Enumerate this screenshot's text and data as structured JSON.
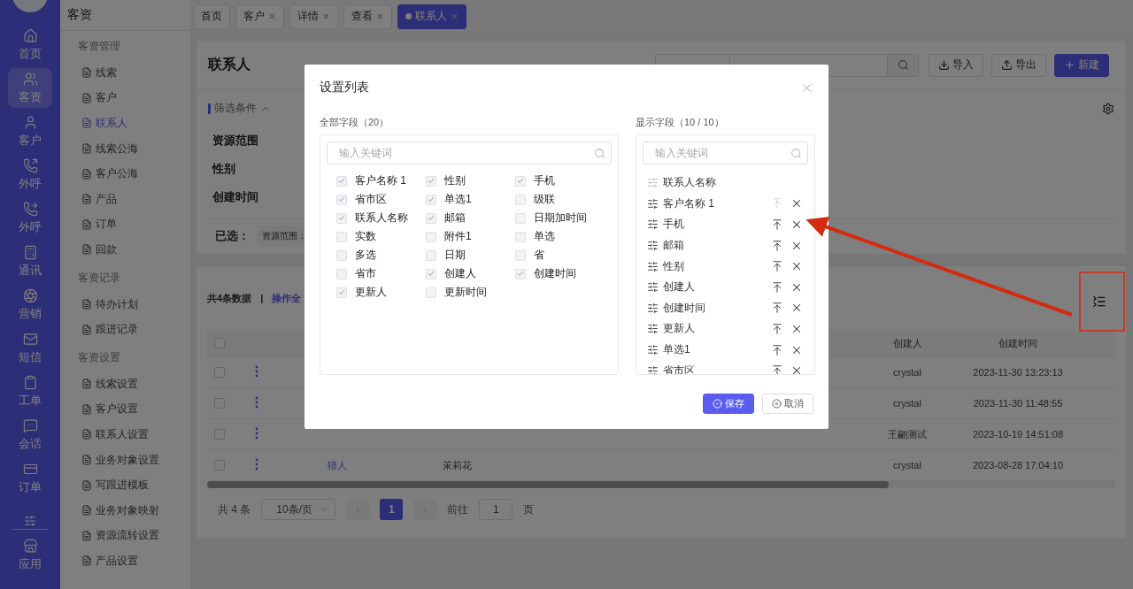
{
  "icon_nav": {
    "items": [
      {
        "label": "首页",
        "selected": false
      },
      {
        "label": "客资",
        "selected": true
      },
      {
        "label": "客户",
        "selected": false
      },
      {
        "label": "外呼",
        "selected": false
      },
      {
        "label": "外呼",
        "selected": false
      },
      {
        "label": "通讯",
        "selected": false
      },
      {
        "label": "营销",
        "selected": false
      },
      {
        "label": "短信",
        "selected": false
      },
      {
        "label": "工单",
        "selected": false
      },
      {
        "label": "会话",
        "selected": false
      },
      {
        "label": "订单",
        "selected": false
      }
    ],
    "footer_item": {
      "label": "应用",
      "selected": false
    }
  },
  "sub_nav": {
    "title": "客资",
    "groups": [
      {
        "title": "客资管理",
        "items": [
          {
            "label": "线索",
            "selected": false
          },
          {
            "label": "客户",
            "selected": false
          },
          {
            "label": "联系人",
            "selected": true
          },
          {
            "label": "线索公海",
            "selected": false
          },
          {
            "label": "客户公海",
            "selected": false
          },
          {
            "label": "产品",
            "selected": false
          },
          {
            "label": "订单",
            "selected": false
          },
          {
            "label": "回款",
            "selected": false
          }
        ]
      },
      {
        "title": "客资记录",
        "items": [
          {
            "label": "待办计划",
            "selected": false
          },
          {
            "label": "跟进记录",
            "selected": false
          }
        ]
      },
      {
        "title": "客资设置",
        "items": [
          {
            "label": "线索设置",
            "selected": false
          },
          {
            "label": "客户设置",
            "selected": false
          },
          {
            "label": "联系人设置",
            "selected": false
          },
          {
            "label": "业务对象设置",
            "selected": false
          },
          {
            "label": "写跟进模板",
            "selected": false
          },
          {
            "label": "业务对象映射",
            "selected": false
          },
          {
            "label": "资源流转设置",
            "selected": false
          },
          {
            "label": "产品设置",
            "selected": false
          }
        ]
      }
    ]
  },
  "tabs": [
    {
      "label": "首页",
      "closable": false,
      "selected": false
    },
    {
      "label": "客户",
      "closable": true,
      "selected": false
    },
    {
      "label": "详情",
      "closable": true,
      "selected": false
    },
    {
      "label": "查看",
      "closable": true,
      "selected": false
    },
    {
      "label": "联系人",
      "closable": true,
      "selected": true
    }
  ],
  "page": {
    "title": "联系人",
    "buttons": [
      {
        "kind": "import",
        "label": "导入"
      },
      {
        "kind": "export",
        "label": "导出"
      },
      {
        "kind": "new",
        "label": "新建"
      }
    ]
  },
  "filters": {
    "title": "筛选条件",
    "expanded": true,
    "rows": [
      "资源范围",
      "性别",
      "创建时间"
    ],
    "selected_label": "已选：",
    "selected_tags": [
      "资源范围："
    ]
  },
  "table": {
    "summary": "共4条数据",
    "separator": "|",
    "bulk_link": "操作全",
    "header_checked": false,
    "columns": [
      {
        "label": "创建人"
      },
      {
        "label": "创建时间"
      }
    ],
    "rows": [
      {
        "checked": false,
        "cells": [
          "crystal",
          "2023-11-30 13:23:13"
        ]
      },
      {
        "checked": false,
        "cells": [
          "crystal",
          "2023-11-30 11:48:55"
        ]
      },
      {
        "checked": false,
        "cells": [
          "王翩测试",
          "2023-10-19 14:51:08"
        ]
      },
      {
        "checked": false,
        "column_3": "猎人",
        "column_4": "茉莉花",
        "cells": [
          "crystal",
          "2023-08-28 17:04:10"
        ]
      }
    ]
  },
  "pagination": {
    "total": "共 4 条",
    "page_size": "10条/页",
    "pages": [
      {
        "label": "1",
        "selected": true
      }
    ],
    "goto_label": "前往",
    "goto_value": "1",
    "goto_suffix": "页"
  },
  "dialog": {
    "title": "设置列表",
    "all_fields": {
      "title": "全部字段（20）",
      "placeholder": "输入关键词",
      "fields": [
        {
          "label": "客户名称 1",
          "checked": true
        },
        {
          "label": "性别",
          "checked": true
        },
        {
          "label": "手机",
          "checked": true
        },
        {
          "label": "省市区",
          "checked": true
        },
        {
          "label": "单选1",
          "checked": true
        },
        {
          "label": "级联",
          "checked": false
        },
        {
          "label": "联系人名称",
          "checked": true
        },
        {
          "label": "邮箱",
          "checked": true
        },
        {
          "label": "日期加时间",
          "checked": false
        },
        {
          "label": "实数",
          "checked": false
        },
        {
          "label": "附件1",
          "checked": false
        },
        {
          "label": "单选",
          "checked": false
        },
        {
          "label": "多选",
          "checked": false
        },
        {
          "label": "日期",
          "checked": false
        },
        {
          "label": "省",
          "checked": false
        },
        {
          "label": "省市",
          "checked": false
        },
        {
          "label": "创建人",
          "checked": true
        },
        {
          "label": "创建时间",
          "checked": true
        },
        {
          "label": "更新人",
          "checked": true
        },
        {
          "label": "更新时间",
          "checked": false
        }
      ]
    },
    "shown_fields": {
      "title": "显示字段（10 / 10）",
      "placeholder": "输入关键词",
      "fields": [
        {
          "label": "联系人名称",
          "kind": "fixed"
        },
        {
          "label": "客户名称 1",
          "kind": "field",
          "top_disabled": true
        },
        {
          "label": "手机",
          "kind": "field",
          "top_disabled": false
        },
        {
          "label": "邮箱",
          "kind": "field",
          "top_disabled": false
        },
        {
          "label": "性别",
          "kind": "field",
          "top_disabled": false
        },
        {
          "label": "创建人",
          "kind": "field",
          "top_disabled": false
        },
        {
          "label": "创建时间",
          "kind": "field",
          "top_disabled": false
        },
        {
          "label": "更新人",
          "kind": "field",
          "top_disabled": false
        },
        {
          "label": "单选1",
          "kind": "field",
          "top_disabled": false
        },
        {
          "label": "省市区",
          "kind": "field",
          "top_disabled": false
        }
      ]
    },
    "buttons": [
      {
        "kind": "primary",
        "label": "保存"
      },
      {
        "kind": "default",
        "label": "取消"
      }
    ]
  }
}
